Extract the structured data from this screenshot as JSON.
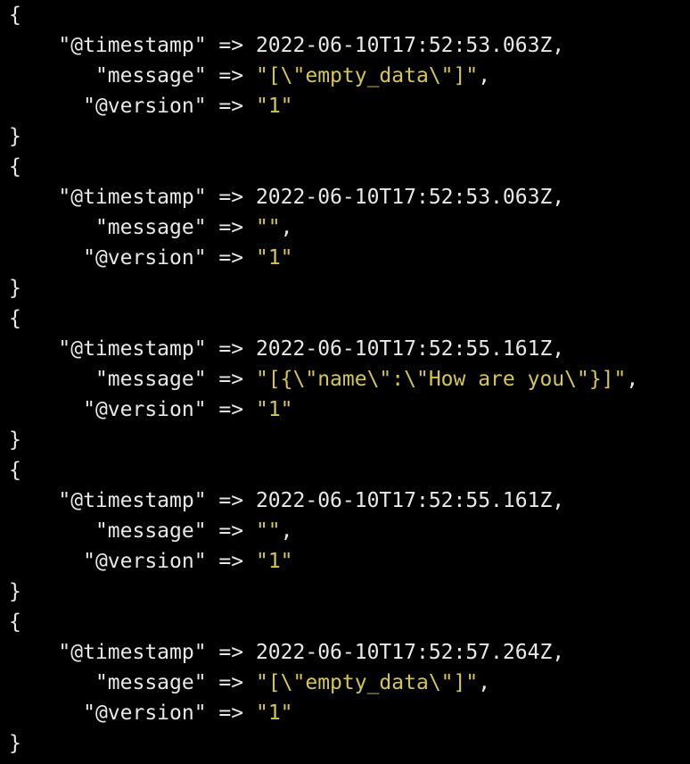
{
  "colors": {
    "background": "#000000",
    "text": "#e8e8e8",
    "string": "#d4c84a"
  },
  "symbols": {
    "open_brace": "{",
    "close_brace": "}",
    "arrow": " => ",
    "comma": ","
  },
  "records": [
    {
      "timestamp_key": "\"@timestamp\"",
      "timestamp_value": "2022-06-10T17:52:53.063Z",
      "message_key": "\"message\"",
      "message_value": "\"[\\\"empty_data\\\"]\"",
      "version_key": "\"@version\"",
      "version_value": "\"1\""
    },
    {
      "timestamp_key": "\"@timestamp\"",
      "timestamp_value": "2022-06-10T17:52:53.063Z",
      "message_key": "\"message\"",
      "message_value": "\"\"",
      "version_key": "\"@version\"",
      "version_value": "\"1\""
    },
    {
      "timestamp_key": "\"@timestamp\"",
      "timestamp_value": "2022-06-10T17:52:55.161Z",
      "message_key": "\"message\"",
      "message_value": "\"[{\\\"name\\\":\\\"How are you\\\"}]\"",
      "version_key": "\"@version\"",
      "version_value": "\"1\""
    },
    {
      "timestamp_key": "\"@timestamp\"",
      "timestamp_value": "2022-06-10T17:52:55.161Z",
      "message_key": "\"message\"",
      "message_value": "\"\"",
      "version_key": "\"@version\"",
      "version_value": "\"1\""
    },
    {
      "timestamp_key": "\"@timestamp\"",
      "timestamp_value": "2022-06-10T17:52:57.264Z",
      "message_key": "\"message\"",
      "message_value": "\"[\\\"empty_data\\\"]\"",
      "version_key": "\"@version\"",
      "version_value": "\"1\""
    }
  ]
}
